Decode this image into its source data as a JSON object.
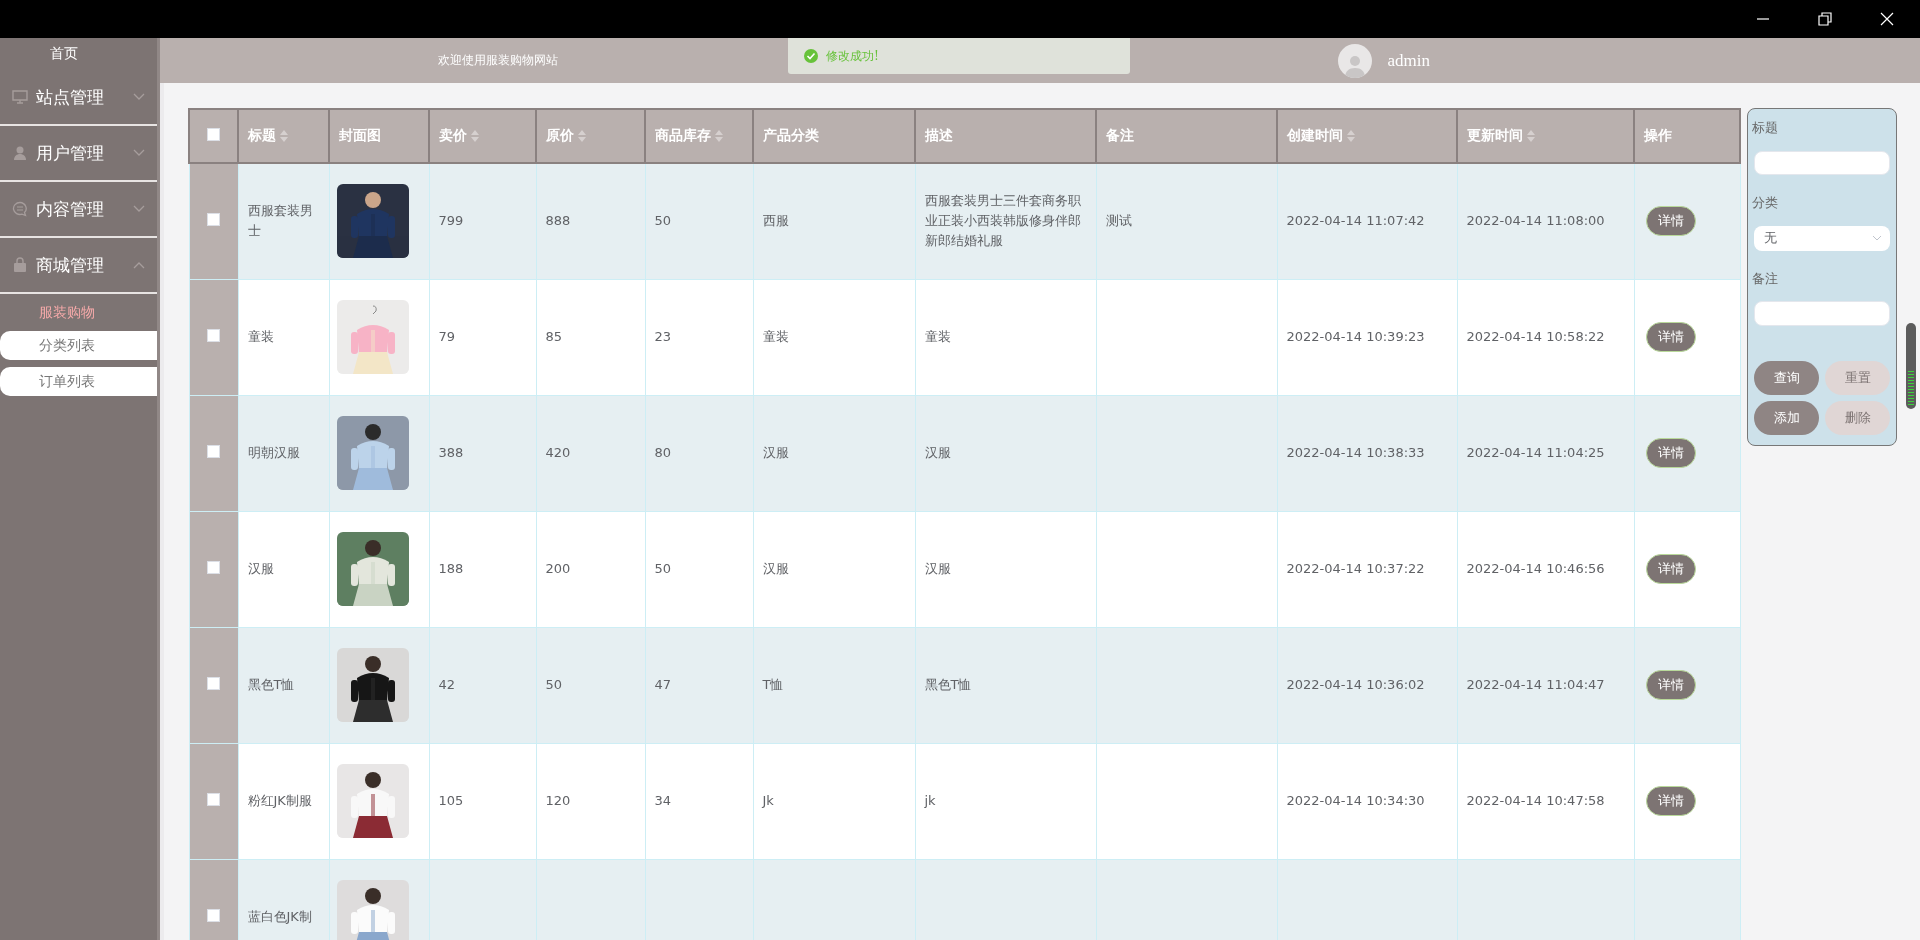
{
  "sidebar": {
    "home": "首页",
    "menus": [
      {
        "label": "站点管理",
        "expanded": false
      },
      {
        "label": "用户管理",
        "expanded": false
      },
      {
        "label": "内容管理",
        "expanded": false
      },
      {
        "label": "商城管理",
        "expanded": true,
        "children": [
          {
            "label": "服装购物",
            "kind": "group"
          },
          {
            "label": "分类列表",
            "kind": "link"
          },
          {
            "label": "订单列表",
            "kind": "link"
          }
        ]
      }
    ]
  },
  "header": {
    "welcome": "欢迎使用服装购物网站",
    "toast": "修改成功!",
    "user": "admin"
  },
  "table": {
    "select_all": false,
    "columns": [
      {
        "label": "标题",
        "sortable": true
      },
      {
        "label": "封面图",
        "sortable": false
      },
      {
        "label": "卖价",
        "sortable": true
      },
      {
        "label": "原价",
        "sortable": true
      },
      {
        "label": "商品库存",
        "sortable": true
      },
      {
        "label": "产品分类",
        "sortable": false
      },
      {
        "label": "描述",
        "sortable": false
      },
      {
        "label": "备注",
        "sortable": false
      },
      {
        "label": "创建时间",
        "sortable": true
      },
      {
        "label": "更新时间",
        "sortable": true
      },
      {
        "label": "操作",
        "sortable": false
      }
    ],
    "rows": [
      {
        "checked": false,
        "title": "西服套装男士",
        "price": "799",
        "original_price": "888",
        "stock": "50",
        "category": "西服",
        "description": "西服套装男士三件套商务职业正装小西装韩版修身伴郎新郎结婚礼服",
        "note": "测试",
        "created": "2022-04-14 11:07:42",
        "updated": "2022-04-14 11:08:00",
        "action": "详情"
      },
      {
        "checked": false,
        "title": "童装",
        "price": "79",
        "original_price": "85",
        "stock": "23",
        "category": "童装",
        "description": "童装",
        "created": "2022-04-14 10:39:23",
        "updated": "2022-04-14 10:58:22",
        "action": "详情"
      },
      {
        "checked": false,
        "title": "明朝汉服",
        "price": "388",
        "original_price": "420",
        "stock": "80",
        "category": "汉服",
        "description": "汉服",
        "created": "2022-04-14 10:38:33",
        "updated": "2022-04-14 11:04:25",
        "action": "详情"
      },
      {
        "checked": false,
        "title": "汉服",
        "price": "188",
        "original_price": "200",
        "stock": "50",
        "category": "汉服",
        "description": "汉服",
        "created": "2022-04-14 10:37:22",
        "updated": "2022-04-14 10:46:56",
        "action": "详情"
      },
      {
        "checked": false,
        "title": "黑色T恤",
        "price": "42",
        "original_price": "50",
        "stock": "47",
        "category": "T恤",
        "description": "黑色T恤",
        "created": "2022-04-14 10:36:02",
        "updated": "2022-04-14 11:04:47",
        "action": "详情"
      },
      {
        "checked": false,
        "title": "粉红JK制服",
        "price": "105",
        "original_price": "120",
        "stock": "34",
        "category": "Jk",
        "description": "jk",
        "created": "2022-04-14 10:34:30",
        "updated": "2022-04-14 10:47:58",
        "action": "详情"
      },
      {
        "checked": false,
        "title": "蓝白色JK制"
      }
    ]
  },
  "filter": {
    "fields": [
      {
        "label": "标题",
        "kind": "text"
      },
      {
        "label": "分类",
        "kind": "select",
        "value": "无"
      },
      {
        "label": "备注",
        "kind": "text"
      }
    ],
    "buttons": [
      {
        "label": "查询",
        "disabled": false
      },
      {
        "label": "重置",
        "disabled": true
      },
      {
        "label": "添加",
        "disabled": false
      },
      {
        "label": "删除",
        "disabled": true
      }
    ]
  }
}
